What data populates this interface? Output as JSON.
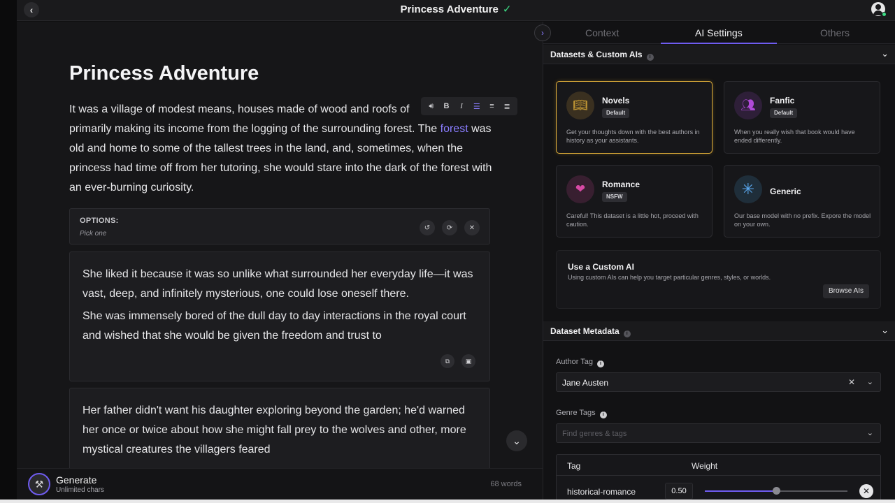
{
  "topbar": {
    "title": "Princess Adventure"
  },
  "editor": {
    "title": "Princess Adventure",
    "story_before": "It was a village of modest means, houses made of wood and roofs of",
    "story_mid": " primarily making its income from the logging of the surrounding forest. The ",
    "story_link": "forest",
    "story_after": " was old and home to some of the tallest trees in the land, and, sometimes, when the princess had time off from her tutoring, she would stare into the dark of the forest with an ever-burning curiosity.",
    "toolbar": [
      "speaker-icon",
      "bold-icon",
      "italic-icon",
      "align-left-icon",
      "align-center-icon",
      "align-right-icon"
    ],
    "options_label": "OPTIONS:",
    "options_sub": "Pick one",
    "option1_p1": "She liked it because it was so unlike what surrounded her everyday life—it was vast, deep, and infinitely mysterious, one could lose oneself there.",
    "option1_p2": "She was immensely bored of the dull day to day interactions in the royal court and wished that she would be given the freedom and trust to",
    "option2": "Her father didn't want his daughter exploring beyond the garden; he'd warned her once or twice about how she might fall prey to the wolves and other, more mystical creatures the villagers feared"
  },
  "generate": {
    "label": "Generate",
    "sub": "Unlimited chars",
    "word_count": "68 words"
  },
  "panel": {
    "tabs": [
      "Context",
      "AI Settings",
      "Others"
    ],
    "active_tab": "AI Settings",
    "datasets_title": "Datasets & Custom AIs",
    "datasets": [
      {
        "name": "Novels",
        "badge": "Default",
        "desc": "Get your thoughts down with the best authors in history as your assistants.",
        "icon": "book-icon",
        "color": "#e6b33a"
      },
      {
        "name": "Fanfic",
        "badge": "Default",
        "desc": "When you really wish that book would have ended differently.",
        "icon": "people-icon",
        "color": "#b04ad8"
      },
      {
        "name": "Romance",
        "badge": "NSFW",
        "desc": "Careful! This dataset is a little hot, proceed with caution.",
        "icon": "bookmark-heart-icon",
        "color": "#d84aa5"
      },
      {
        "name": "Generic",
        "badge": "",
        "desc": "Our base model with no prefix. Expore the model on your own.",
        "icon": "asterisk-icon",
        "color": "#5aa8f0"
      }
    ],
    "custom_title": "Use a Custom AI",
    "custom_desc": "Using custom AIs can help you target particular genres, styles, or worlds.",
    "browse_label": "Browse AIs",
    "metadata_title": "Dataset Metadata",
    "author_label": "Author Tag",
    "author_value": "Jane Austen",
    "genre_label": "Genre Tags",
    "genre_placeholder": "Find genres & tags",
    "table_tag_header": "Tag",
    "table_weight_header": "Weight",
    "tag_rows": [
      {
        "tag": "historical-romance",
        "weight": "0.50"
      }
    ]
  }
}
